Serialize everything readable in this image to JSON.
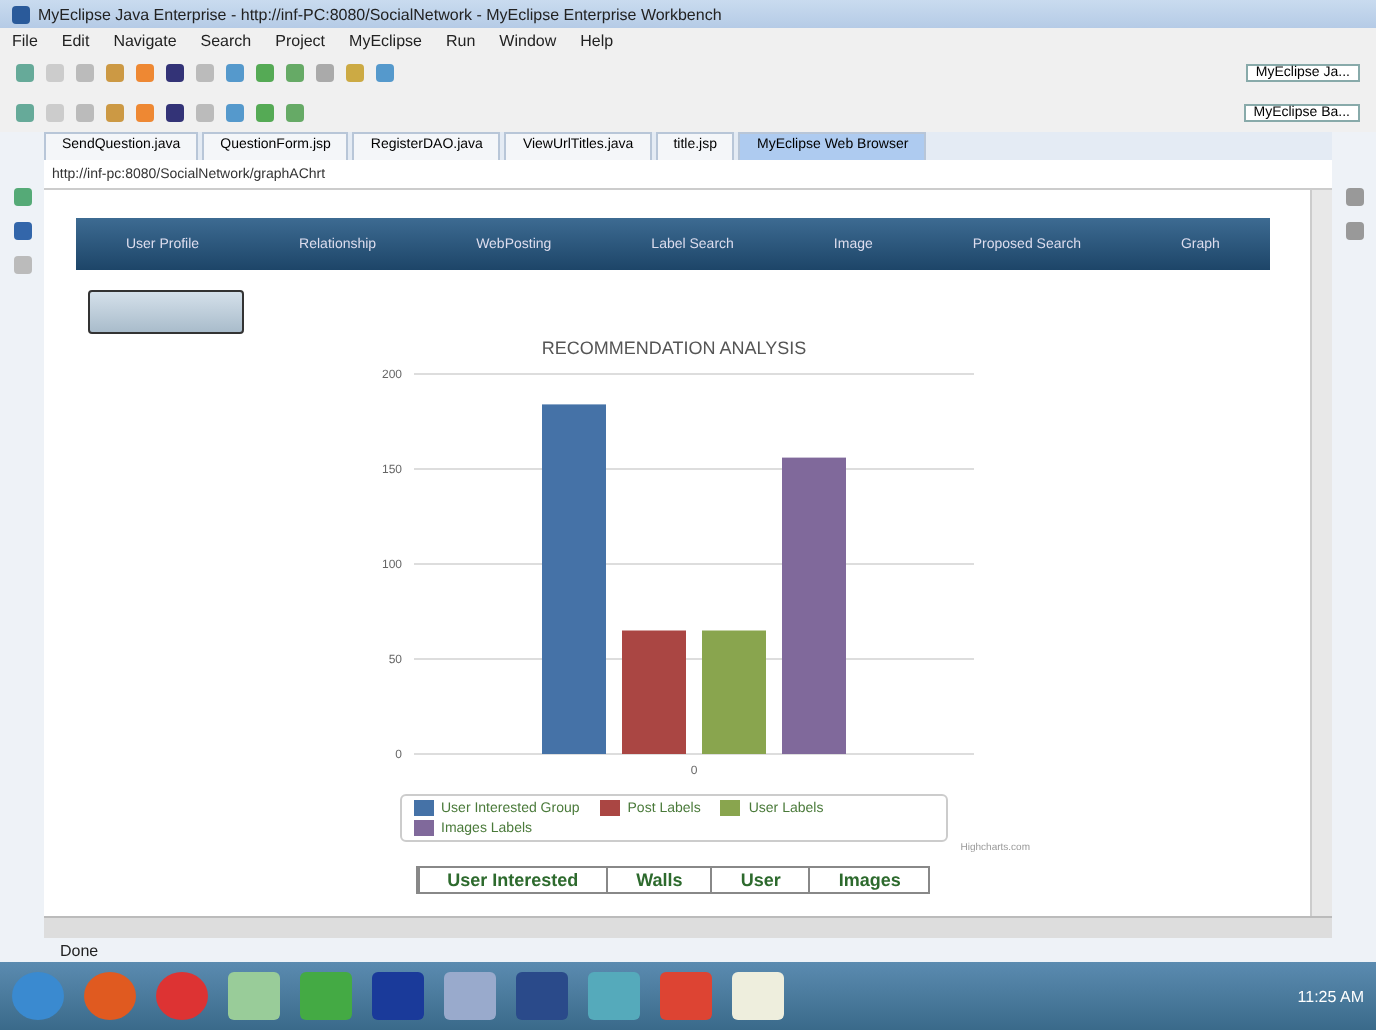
{
  "window": {
    "title": "MyEclipse Java Enterprise - http://inf-PC:8080/SocialNetwork - MyEclipse Enterprise Workbench"
  },
  "menu": [
    "File",
    "Edit",
    "Navigate",
    "Search",
    "Project",
    "MyEclipse",
    "Run",
    "Window",
    "Help"
  ],
  "perspectives": [
    "MyEclipse Ja...",
    "MyEclipse Ba..."
  ],
  "editor_tabs": [
    {
      "label": "SendQuestion.java",
      "selected": false
    },
    {
      "label": "QuestionForm.jsp",
      "selected": false
    },
    {
      "label": "RegisterDAO.java",
      "selected": false
    },
    {
      "label": "ViewUrlTitles.java",
      "selected": false
    },
    {
      "label": "title.jsp",
      "selected": false
    },
    {
      "label": "MyEclipse Web Browser",
      "selected": true
    }
  ],
  "browser": {
    "url": "http://inf-pc:8080/SocialNetwork/graphAChrt"
  },
  "nav": [
    {
      "label": "User Profile"
    },
    {
      "label": "Relationship"
    },
    {
      "label": "WebPosting"
    },
    {
      "label": "Label Search"
    },
    {
      "label": "Image"
    },
    {
      "label": "Proposed Search"
    },
    {
      "label": "Graph"
    }
  ],
  "chart_data": {
    "type": "bar",
    "title": "RECOMMENDATION ANALYSIS",
    "categories": [
      "0"
    ],
    "ylim": [
      0,
      200
    ],
    "yticks": [
      0,
      50,
      100,
      150,
      200
    ],
    "series": [
      {
        "name": "User Interested Group",
        "color": "#4572a7",
        "values": [
          184
        ]
      },
      {
        "name": "Post Labels",
        "color": "#aa4643",
        "values": [
          65
        ]
      },
      {
        "name": "User Labels",
        "color": "#89a54e",
        "values": [
          65
        ]
      },
      {
        "name": "Images Labels",
        "color": "#80699b",
        "values": [
          156
        ]
      }
    ],
    "grid": true
  },
  "chart_credits": "Highcharts.com",
  "table": {
    "columns": [
      "User Interested",
      "Walls",
      "User",
      "Images"
    ]
  },
  "status_bar": {
    "text": "Done"
  },
  "taskbar": {
    "clock": "11:25 AM"
  }
}
